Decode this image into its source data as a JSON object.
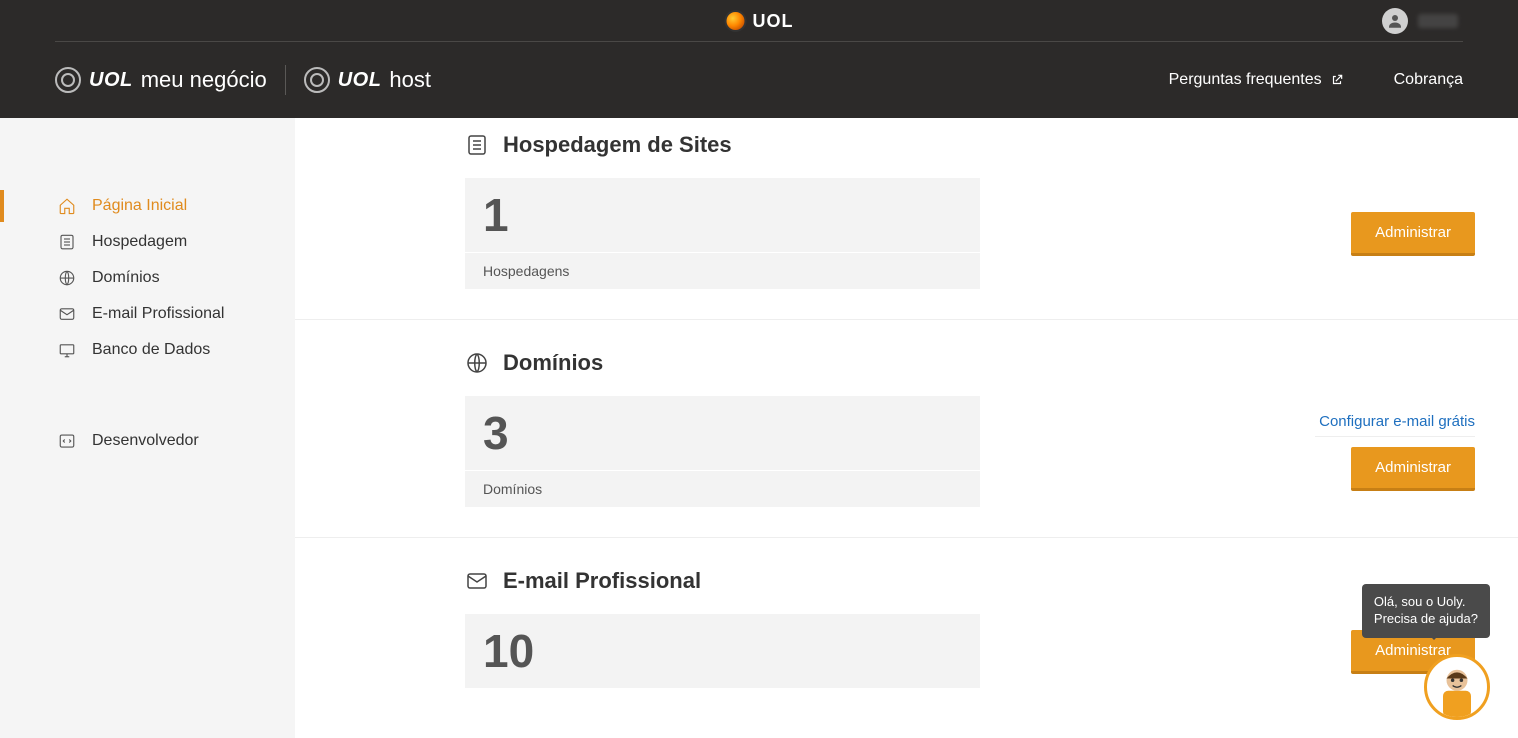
{
  "header": {
    "logo_text": "UOL",
    "brand1_uol": "UOL",
    "brand1_sub": "meu negócio",
    "brand2_uol": "UOL",
    "brand2_sub": "host",
    "faq": "Perguntas frequentes",
    "billing": "Cobrança"
  },
  "sidebar": {
    "items": [
      {
        "label": "Página Inicial"
      },
      {
        "label": "Hospedagem"
      },
      {
        "label": "Domínios"
      },
      {
        "label": "E-mail Profissional"
      },
      {
        "label": "Banco de Dados"
      },
      {
        "label": "Desenvolvedor"
      }
    ]
  },
  "panels": {
    "hosting": {
      "title": "Hospedagem de Sites",
      "value": "1",
      "unit": "Hospedagens",
      "action": "Administrar"
    },
    "domains": {
      "title": "Domínios",
      "value": "3",
      "unit": "Domínios",
      "link": "Configurar e-mail grátis",
      "action": "Administrar"
    },
    "email": {
      "title": "E-mail Profissional",
      "value": "10",
      "action": "Administrar"
    }
  },
  "chat": {
    "line1": "Olá, sou o Uoly.",
    "line2": "Precisa de ajuda?"
  }
}
